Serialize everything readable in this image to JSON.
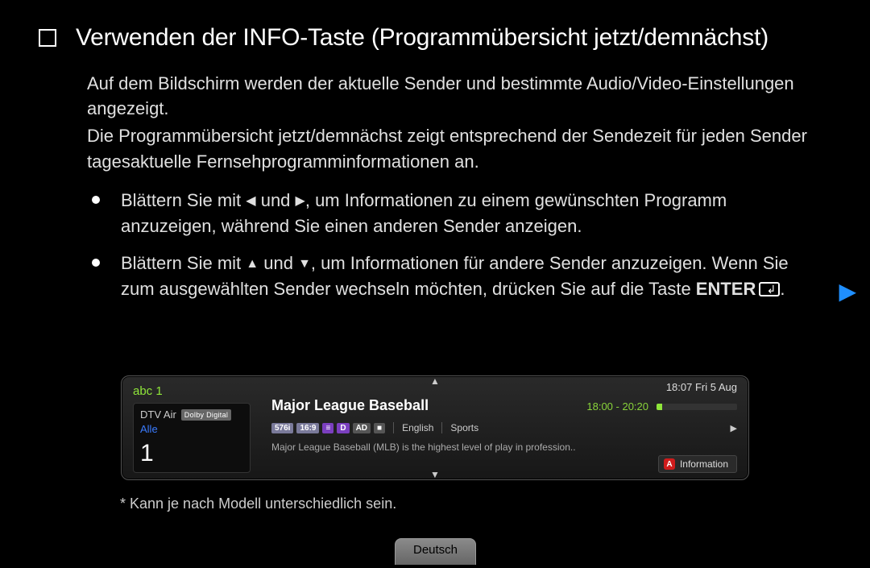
{
  "heading": "Verwenden der INFO-Taste (Programmübersicht jetzt/demnächst)",
  "intro1": "Auf dem Bildschirm werden der aktuelle Sender und bestimmte Audio/Video-Einstellungen angezeigt.",
  "intro2": "Die Programmübersicht jetzt/demnächst zeigt entsprechend der Sendezeit für jeden Sender tagesaktuelle Fernsehprogramminformationen an.",
  "bullets": [
    {
      "pre": "Blättern Sie mit ",
      "g1": "◀",
      "mid": " und ",
      "g2": "▶",
      "post": ", um Informationen zu einem gewünschten Programm anzuzeigen, während Sie einen anderen Sender anzeigen."
    },
    {
      "pre": "Blättern Sie mit ",
      "g1": "▲",
      "mid": " und ",
      "g2": "▼",
      "post": ", um Informationen für andere Sender anzuzeigen. Wenn Sie zum ausgewählten Sender wechseln möchten, drücken Sie auf die Taste ",
      "enter": "ENTER",
      "tail": "."
    }
  ],
  "panel": {
    "channel_name": "abc 1",
    "dtv": "DTV Air",
    "dolby": "Dolby Digital",
    "alle": "Alle",
    "num": "1",
    "datetime": "18:07 Fri 5 Aug",
    "prog_title": "Major League Baseball",
    "prog_time": "18:00 - 20:20",
    "badges": {
      "b1": "576i",
      "b2": "16:9",
      "b3": "≡",
      "b4": "D",
      "b5": "AD",
      "b6": "■"
    },
    "lang": "English",
    "genre": "Sports",
    "desc": "Major League Baseball (MLB) is the highest level of play in profession..",
    "info_label": "Information",
    "info_key": "A"
  },
  "footnote": "* Kann je nach Modell unterschiedlich sein.",
  "lang_button": "Deutsch",
  "glyphs": {
    "next": "▶",
    "up": "▲",
    "down": "▼",
    "chev": "▶"
  }
}
